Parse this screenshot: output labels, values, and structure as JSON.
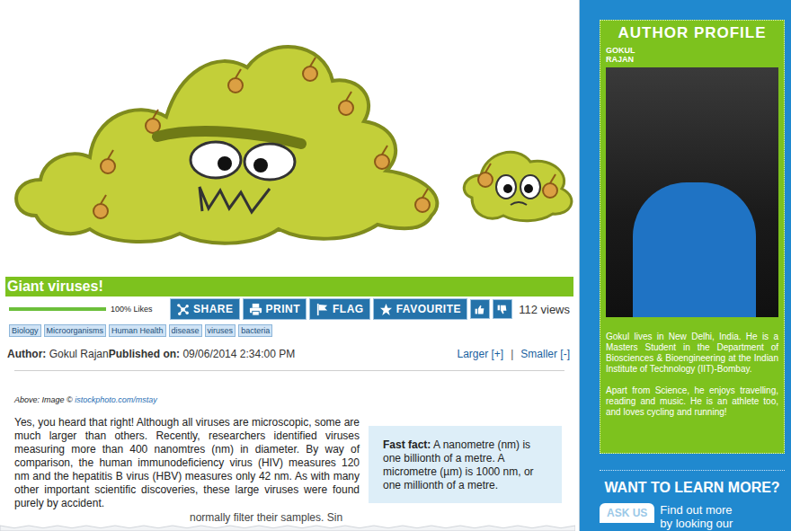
{
  "article": {
    "title": "Giant viruses!",
    "likes": {
      "label": "100% Likes",
      "level": 1
    },
    "actions": [
      {
        "label": "SHARE",
        "kind": "share"
      },
      {
        "label": "PRINT",
        "kind": "print"
      },
      {
        "label": "FLAG",
        "kind": "flag"
      },
      {
        "label": "FAVOURITE",
        "kind": "star"
      }
    ],
    "views": "112 views",
    "tags": [
      "Biology",
      "Microorganisms",
      "Human Health",
      "disease",
      "viruses",
      "bacteria"
    ],
    "byline": {
      "author_label": "Author:",
      "author": "Gokul Rajan",
      "published_label": "Published on:",
      "published": "09/06/2014 2:34:00 PM"
    },
    "text_size": {
      "larger": "Larger [+]",
      "separator": "|",
      "smaller": "Smaller [-]"
    },
    "caption": {
      "prefix": "Above: Image ©",
      "link": "istockphoto.com/mstay"
    },
    "paragraph": "Yes, you heard that right! Although all viruses are microscopic, some are much larger than others. Recently, researchers identified viruses measuring more than 400 nanomtres (nm) in diameter. By way of comparison, the human immunodeficiency virus (HIV) measures 120 nm and the hepatitis B virus (HBV) measures only 42 nm. As with many other important scientific discoveries, these large viruses were found purely by accident.",
    "fast_fact": {
      "label": "Fast fact:",
      "text": "A nanometre (nm) is one billionth of a metre. A micrometre (µm) is 1000 nm, or one millionth of a metre."
    },
    "cut_line": "normally filter their samples. Sin"
  },
  "author_profile": {
    "heading": "AUTHOR PROFILE",
    "name": [
      "GOKUL",
      "RAJAN"
    ],
    "bio": [
      "Gokul lives in New Delhi, India. He is a Masters Student in the Department of Biosciences & Bioengineering at the Indian Institute of Technology (IIT)-Bombay.",
      "Apart from Science, he enjoys travelling, reading and music. He is an athlete too, and loves cycling and running!"
    ]
  },
  "learn_more": {
    "heading": "WANT TO LEARN MORE?",
    "badge": "ASK US",
    "lines": [
      "Find out more",
      "by looking our"
    ]
  }
}
